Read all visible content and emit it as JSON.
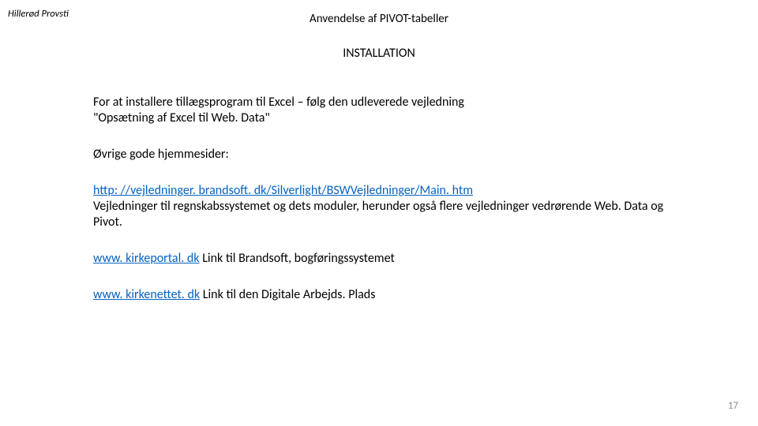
{
  "header": {
    "left": "Hillerød Provsti",
    "center": "Anvendelse af PIVOT-tabeller"
  },
  "title": "INSTALLATION",
  "body": {
    "intro": "For at installere tillægsprogram til Excel – følg den udleverede vejledning \"Opsætning af Excel til Web. Data\"",
    "other_sites_label": "Øvrige gode hjemmesider:",
    "link1_text": "http: //vejledninger. brandsoft. dk/Silverlight/BSWVejledninger/Main. htm",
    "link1_desc": "Vejledninger til regnskabssystemet og dets moduler, herunder også flere vejledninger vedrørende Web. Data og Pivot.",
    "link2_text": "www. kirkeportal. dk",
    "link2_desc": " Link til Brandsoft, bogføringssystemet",
    "link3_text": "www. kirkenettet. dk",
    "link3_desc": " Link til den Digitale Arbejds. Plads"
  },
  "page_number": "17"
}
